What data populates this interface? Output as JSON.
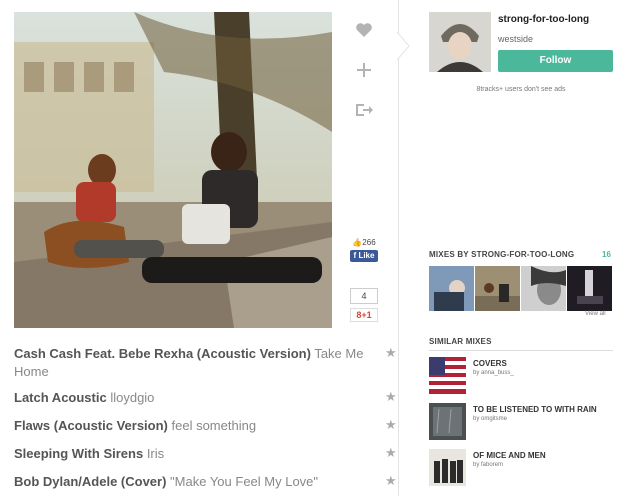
{
  "actions": {
    "like_icon": "heart-icon",
    "add_icon": "plus-icon",
    "share_icon": "share-icon"
  },
  "social": {
    "like_count": "266",
    "fb_label": "Like",
    "gplus_count": "4",
    "gplus_label": "8+1"
  },
  "user": {
    "name": "strong-for-too-long",
    "location": "westside",
    "follow_label": "Follow",
    "ads_note": "8tracks+ users don't see ads"
  },
  "mixes_by": {
    "title": "MIXES BY STRONG-FOR-TOO-LONG",
    "count": "16",
    "view_all": "View all"
  },
  "similar": {
    "title": "SIMILAR MIXES",
    "items": [
      {
        "title": "COVERS",
        "by": "by anna_buss_"
      },
      {
        "title": "TO BE LISTENED TO WITH RAIN",
        "by": "by omgitsme"
      },
      {
        "title": "OF MICE AND MEN",
        "by": "by faborem"
      }
    ]
  },
  "tracks": [
    {
      "title": "Cash Cash Feat. Bebe Rexha (Acoustic Version)",
      "artist": "Take Me Home"
    },
    {
      "title": "Latch Acoustic",
      "artist": "lloydgio"
    },
    {
      "title": "Flaws (Acoustic Version)",
      "artist": "feel something"
    },
    {
      "title": "Sleeping With Sirens",
      "artist": "Iris"
    },
    {
      "title": "Bob Dylan/Adele (Cover)",
      "artist": "\"Make You Feel My Love\""
    }
  ],
  "colors": {
    "accent": "#4bb89b",
    "facebook": "#3b5998"
  }
}
